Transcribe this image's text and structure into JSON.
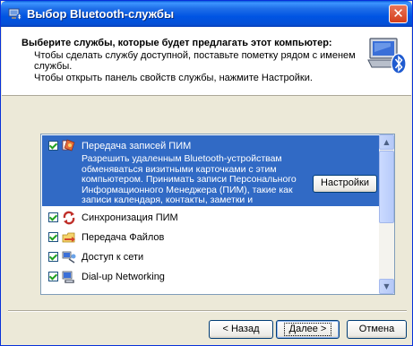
{
  "window": {
    "title": "Выбор Bluetooth-службы",
    "close_symbol": "✕"
  },
  "header": {
    "title": "Выберите службы, которые будет предлагать этот компьютер:",
    "line1": "Чтобы сделать службу доступной, поставьте пометку рядом с именем",
    "line2": "службы.",
    "line3": "Чтобы открыть панель свойств службы, нажмите Настройки.",
    "icon": "bluetooth-computer-icon"
  },
  "services": {
    "selected": {
      "label": "Передача записей ПИМ",
      "checked": true,
      "icon": "pim-transfer-icon",
      "description": "Разрешить удаленным Bluetooth-устройствам обменяваться визитными карточками с этим компьютером. Принимать записи Персонального Информационного Менеджера (ПИМ), такие как записи календаря, контакты, заметки и сообщения с удаленного Bluetooth-устройства.",
      "settings_label": "Настройки"
    },
    "items": [
      {
        "label": "Синхронизация ПИМ",
        "checked": true,
        "icon": "pim-sync-icon"
      },
      {
        "label": "Передача Файлов",
        "checked": true,
        "icon": "file-transfer-icon"
      },
      {
        "label": "Доступ к сети",
        "checked": true,
        "icon": "network-access-icon"
      },
      {
        "label": "Dial-up Networking",
        "checked": true,
        "icon": "dialup-networking-icon"
      }
    ]
  },
  "scrollbar": {
    "up_symbol": "▲",
    "down_symbol": "▼"
  },
  "buttons": {
    "back": "< Назад",
    "next": "Далее >",
    "cancel": "Отмена"
  }
}
